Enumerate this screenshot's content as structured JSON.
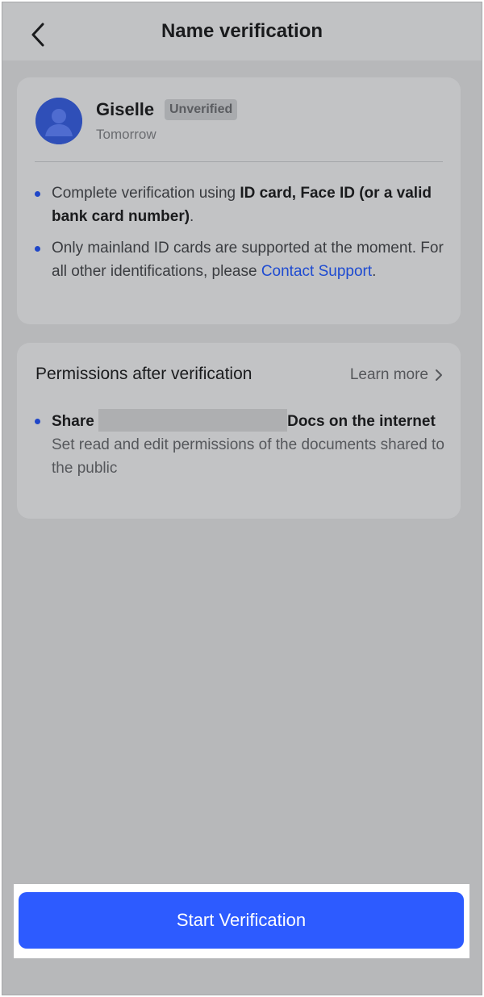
{
  "header": {
    "title": "Name verification",
    "back_icon": "chevron-left-icon"
  },
  "user": {
    "name": "Giselle",
    "status": "Unverified",
    "subtitle": "Tomorrow",
    "avatar_icon": "user-avatar-icon"
  },
  "info": {
    "bullet1_prefix": "Complete verification using ",
    "bullet1_bold": "ID card, Face ID (or a valid bank card number)",
    "bullet1_suffix": ".",
    "bullet2_text": "Only mainland ID cards are supported at the moment. For all other identifications, please ",
    "bullet2_link": "Contact Support",
    "bullet2_suffix": "."
  },
  "permissions": {
    "title": "Permissions after verification",
    "learn_more": "Learn more",
    "item_bold_prefix": "Share",
    "item_bold_suffix": "Docs on the internet",
    "item_desc": "Set read and edit permissions of the documents shared to the public"
  },
  "footer": {
    "button_label": "Start Verification"
  },
  "colors": {
    "accent": "#2d5bff",
    "link": "#1e4bd1",
    "bullet": "#1f46c8"
  }
}
